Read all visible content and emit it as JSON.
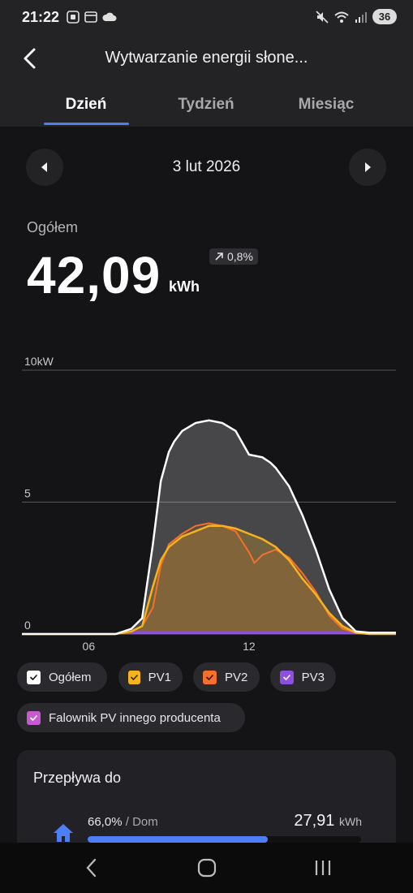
{
  "status_bar": {
    "time": "21:22",
    "battery": "36"
  },
  "header": {
    "title": "Wytwarzanie energii słone...",
    "tabs": [
      {
        "label": "Dzień",
        "active": true
      },
      {
        "label": "Tydzień",
        "active": false
      },
      {
        "label": "Miesiąc",
        "active": false
      }
    ]
  },
  "date_nav": {
    "date": "3 lut 2026"
  },
  "summary": {
    "label": "Ogółem",
    "value": "42,09",
    "unit": "kWh",
    "change": "0,8%"
  },
  "chart_data": {
    "type": "area",
    "y_unit": "kW",
    "ylim": [
      0,
      10
    ],
    "y_ticks": [
      "10kW",
      "5",
      "0"
    ],
    "x_ticks": [
      "06",
      "12"
    ],
    "xlim": [
      3.5,
      17.5
    ],
    "grid": true,
    "series": [
      {
        "name": "Ogółem",
        "color": "#ffffff",
        "x": [
          3.5,
          7.0,
          7.6,
          8.0,
          8.4,
          8.7,
          9.0,
          9.2,
          9.5,
          10.0,
          10.5,
          11.0,
          11.5,
          12.0,
          12.5,
          12.8,
          13.0,
          13.5,
          14.0,
          14.5,
          15.0,
          15.5,
          16.0,
          16.5,
          17.5
        ],
        "values": [
          0,
          0,
          0.2,
          0.6,
          3.4,
          5.8,
          6.9,
          7.3,
          7.7,
          8.0,
          8.1,
          8.0,
          7.7,
          6.8,
          6.7,
          6.5,
          6.3,
          5.6,
          4.5,
          3.2,
          1.7,
          0.6,
          0.1,
          0.05,
          0.05
        ]
      },
      {
        "name": "PV1",
        "color": "#f5b31c",
        "x": [
          3.5,
          7.0,
          7.6,
          8.0,
          8.4,
          8.7,
          9.0,
          9.5,
          10.0,
          10.5,
          11.0,
          11.5,
          12.0,
          12.5,
          13.0,
          13.5,
          14.0,
          14.5,
          15.0,
          15.5,
          16.0,
          16.5,
          17.5
        ],
        "values": [
          0,
          0,
          0.1,
          0.3,
          1.8,
          2.8,
          3.3,
          3.7,
          3.9,
          4.1,
          4.1,
          4.0,
          3.8,
          3.6,
          3.3,
          2.8,
          2.1,
          1.5,
          0.8,
          0.3,
          0.05,
          0,
          0
        ]
      },
      {
        "name": "PV2",
        "color": "#f5702a",
        "x": [
          3.5,
          7.0,
          7.6,
          8.0,
          8.4,
          8.7,
          9.0,
          9.5,
          10.0,
          10.5,
          11.0,
          11.5,
          12.0,
          12.2,
          12.5,
          13.0,
          13.5,
          14.0,
          14.5,
          15.0,
          15.5,
          16.0,
          16.5,
          17.5
        ],
        "values": [
          0,
          0,
          0.1,
          0.3,
          1.0,
          2.6,
          3.4,
          3.8,
          4.1,
          4.2,
          4.1,
          3.9,
          3.1,
          2.7,
          3.0,
          3.2,
          2.9,
          2.3,
          1.6,
          0.7,
          0.2,
          0.05,
          0,
          0
        ]
      },
      {
        "name": "PV3",
        "color": "#8d4fe0",
        "x": [
          7.6,
          16.0
        ],
        "values": [
          0.05,
          0.05
        ]
      }
    ]
  },
  "legend": [
    {
      "label": "Ogółem",
      "check_color": "#ffffff",
      "tick_color": "#111111"
    },
    {
      "label": "PV1",
      "check_color": "#f5b31c",
      "tick_color": "#3a2a00"
    },
    {
      "label": "PV2",
      "check_color": "#f5702a",
      "tick_color": "#3a1400"
    },
    {
      "label": "PV3",
      "check_color": "#8d4fe0",
      "tick_color": "#ffffff"
    },
    {
      "label": "Falownik PV innego producenta",
      "check_color": "#c65bd0",
      "tick_color": "#ffffff"
    }
  ],
  "flow": {
    "title": "Przepływa do",
    "items": [
      {
        "percent": "66,0%",
        "target": "Dom",
        "value": "27,91",
        "unit": "kWh",
        "fraction": 0.66,
        "color": "#4d7ef5",
        "icon": "home-icon"
      }
    ]
  }
}
